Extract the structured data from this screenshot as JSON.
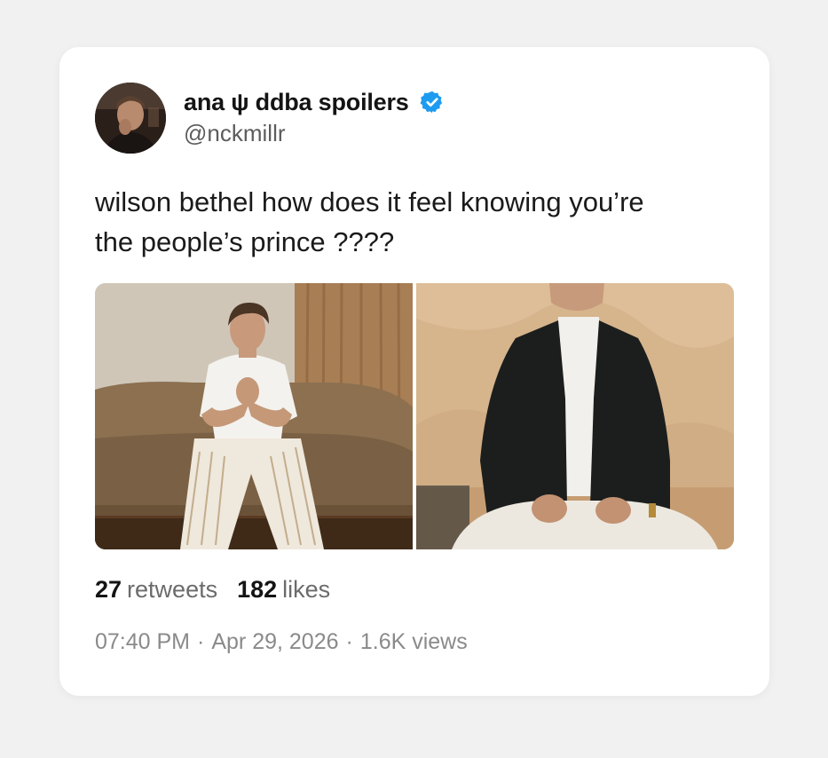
{
  "tweet": {
    "display_name": "ana ψ ddba spoilers",
    "handle": "@nckmillr",
    "verified_icon": "verified-badge-icon",
    "text_line1": "wilson bethel how does it feel knowing you’re",
    "text_line2": "the people’s prince ????",
    "retweets_count": "27",
    "retweets_label": "retweets",
    "likes_count": "182",
    "likes_label": "likes",
    "time": "07:40 PM",
    "separator": "·",
    "date": "Apr 29, 2026",
    "views": "1.6K views"
  },
  "colors": {
    "background": "#f1f1f1",
    "card": "#ffffff",
    "verified_blue": "#1d9bf0",
    "text_primary": "#141414",
    "text_secondary": "#6b6b6b"
  }
}
